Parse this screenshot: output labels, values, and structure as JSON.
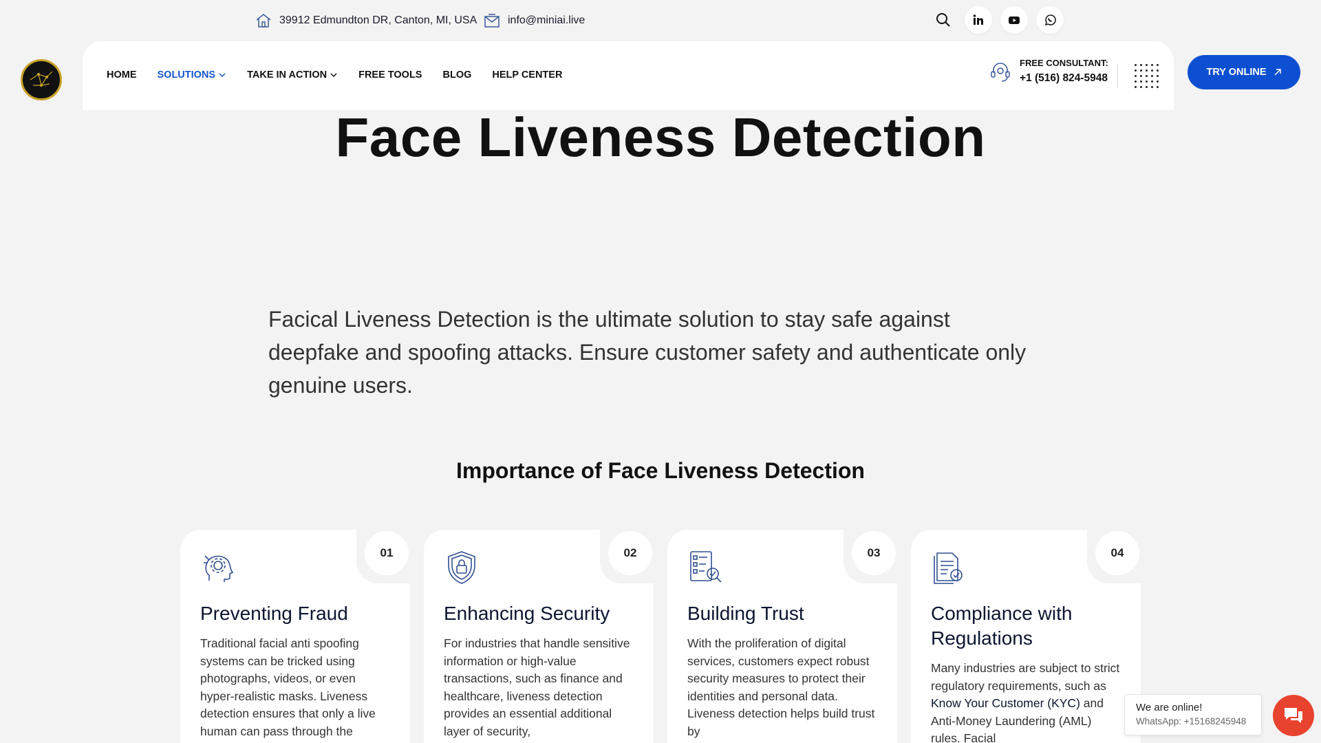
{
  "topbar": {
    "address": "39912 Edmundton DR, Canton, MI, USA",
    "email": "info@miniai.live"
  },
  "nav": {
    "items": [
      {
        "label": "HOME",
        "dropdown": false,
        "active": false
      },
      {
        "label": "SOLUTIONS",
        "dropdown": true,
        "active": true
      },
      {
        "label": "TAKE IN ACTION",
        "dropdown": true,
        "active": false
      },
      {
        "label": "FREE TOOLS",
        "dropdown": false,
        "active": false
      },
      {
        "label": "BLOG",
        "dropdown": false,
        "active": false
      },
      {
        "label": "HELP CENTER",
        "dropdown": false,
        "active": false
      }
    ],
    "consultant_label": "FREE CONSULTANT:",
    "consultant_phone": "+1 (516) 824-5948",
    "try_label": "TRY ONLINE"
  },
  "hero": {
    "title": "Face Liveness Detection",
    "intro": "Facical Liveness Detection is the ultimate solution to stay safe against deepfake and spoofing attacks. Ensure customer safety and authenticate only genuine users."
  },
  "section": {
    "title": "Importance of Face Liveness Detection"
  },
  "cards": [
    {
      "number": "01",
      "icon": "head-gear-icon",
      "title": "Preventing Fraud",
      "body": "Traditional facial anti spoofing systems can be tricked using photographs, videos, or even hyper-realistic masks. Liveness detection ensures that only a live human can pass through the"
    },
    {
      "number": "02",
      "icon": "shield-lock-icon",
      "title": "Enhancing Security",
      "body": "For industries that handle sensitive information or high-value transactions, such as finance and healthcare, liveness detection provides an essential additional layer of security,"
    },
    {
      "number": "03",
      "icon": "checklist-search-icon",
      "title": "Building Trust",
      "body": "With the proliferation of digital services, customers expect robust security measures to protect their identities and personal data. Liveness detection helps build trust by"
    },
    {
      "number": "04",
      "icon": "document-check-icon",
      "title": "Compliance with Regulations",
      "body_pre": "Many industries are subject to strict regulatory requirements, such as ",
      "body_link": "Know Your Customer (KYC)",
      "body_post": " and Anti-Money Laundering (AML) rules. Facial"
    }
  ],
  "chat": {
    "status": "We are online!",
    "whatsapp": "WhatsApp: +15168245948"
  },
  "colors": {
    "accent": "#0c4fd0",
    "chat": "#e8432e",
    "background": "#f3f3f3"
  }
}
